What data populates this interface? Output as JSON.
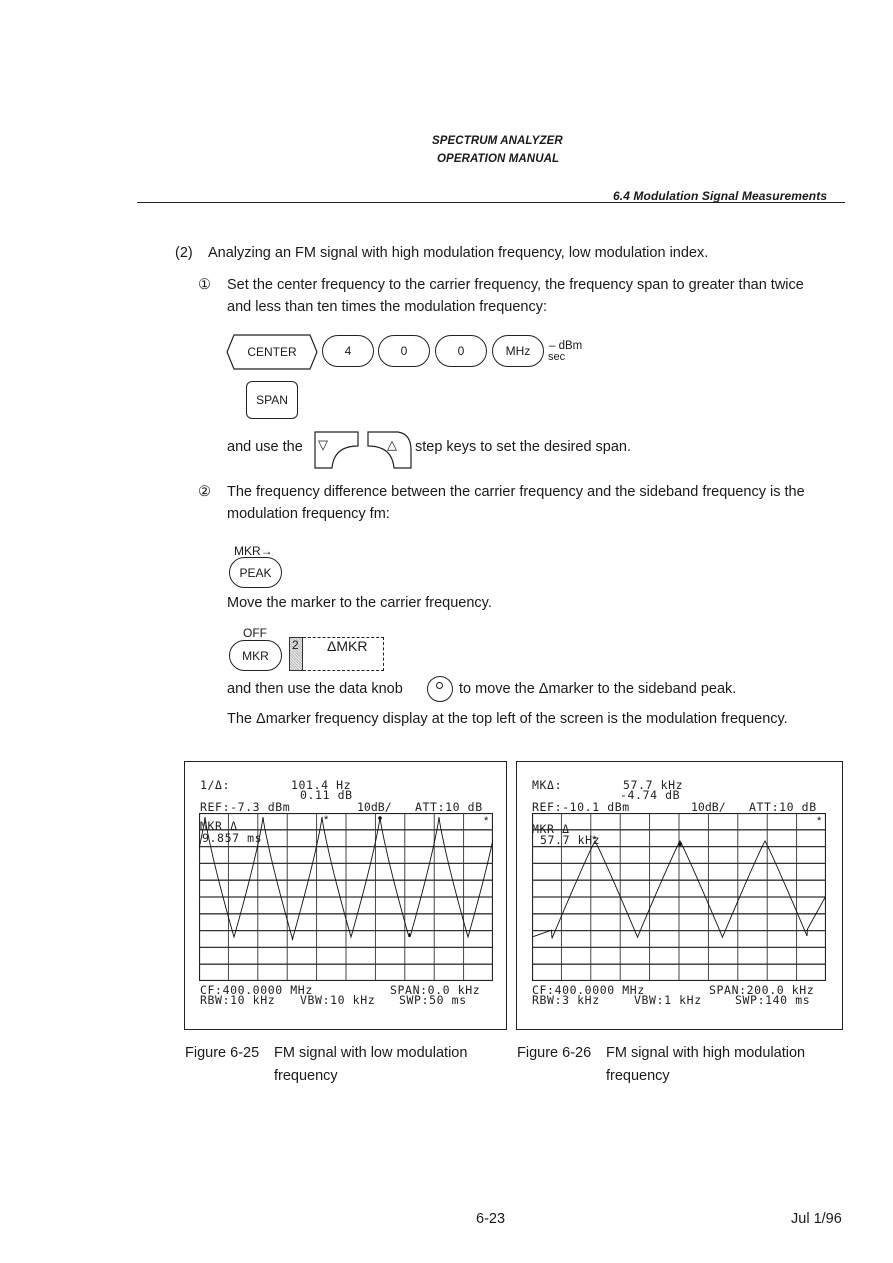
{
  "header": {
    "title_line1": "SPECTRUM ANALYZER",
    "title_line2": "OPERATION MANUAL",
    "section": "6.4  Modulation Signal Measurements"
  },
  "content": {
    "item_number": "(2)",
    "item_heading": "Analyzing an FM signal with high modulation frequency, low modulation index.",
    "step1": {
      "marker": "①",
      "line1": "Set the center frequency to the carrier frequency, the frequency span to greater than twice",
      "line2": "and less than ten times the modulation frequency:",
      "keys": [
        "CENTER",
        "4",
        "0",
        "0",
        "MHz"
      ],
      "mhz_sub_top": "– dBm",
      "mhz_sub_bottom": "sec",
      "span_key": "SPAN",
      "step_text_before": "and use the",
      "step_key_down": "▽",
      "step_key_up": "△",
      "step_text_after": "step keys to set the desired span."
    },
    "step2": {
      "marker": "②",
      "line1": "The frequency difference between the carrier frequency and the sideband frequency is the",
      "line2": "modulation frequency fm:",
      "peak_label_top": "MKR→",
      "peak_key": "PEAK",
      "move_text": "Move the marker to the carrier frequency.",
      "mkr_label_top": "OFF",
      "mkr_key": "MKR",
      "softkey_number": "2",
      "softkey_label": "ΔMKR",
      "knob_text_before": "and then use the data knob",
      "knob_text_after": "to move the Δmarker to the sideband peak.",
      "final_text": "The Δmarker frequency display at the top left of the screen is the modulation frequency."
    }
  },
  "figures": [
    {
      "marker_line1_label": "1/Δ:",
      "marker_line1_value": "101.4 Hz",
      "marker_line2_value": "0.11 dB",
      "ref": "REF:-7.3 dBm",
      "scale": "10dB/",
      "att": "ATT:10 dB",
      "mkr_label": "MKR Δ",
      "mkr_value": "9.857 ms",
      "cf": "CF:400.0000 MHz",
      "span": "SPAN:0.0 kHz",
      "rbw": "RBW:10 kHz",
      "vbw": "VBW:10 kHz",
      "swp": "SWP:50 ms",
      "caption_number": "Figure 6-25",
      "caption_line1": "FM signal with low modulation",
      "caption_line2": "frequency"
    },
    {
      "marker_line1_label": "MKΔ:",
      "marker_line1_value": "57.7 kHz",
      "marker_line2_value": "-4.74 dB",
      "ref": "REF:-10.1 dBm",
      "scale": "10dB/",
      "att": "ATT:10 dB",
      "mkr_label": "MKR Δ",
      "mkr_value": "57.7 kHz",
      "cf": "CF:400.0000 MHz",
      "span": "SPAN:200.0 kHz",
      "rbw": "RBW:3 kHz",
      "vbw": "VBW:1 kHz",
      "swp": "SWP:140 ms",
      "caption_number": "Figure 6-26",
      "caption_line1": "FM signal with high modulation",
      "caption_line2": "frequency"
    }
  ],
  "footer": {
    "page_number": "6-23",
    "date": "Jul 1/96"
  }
}
